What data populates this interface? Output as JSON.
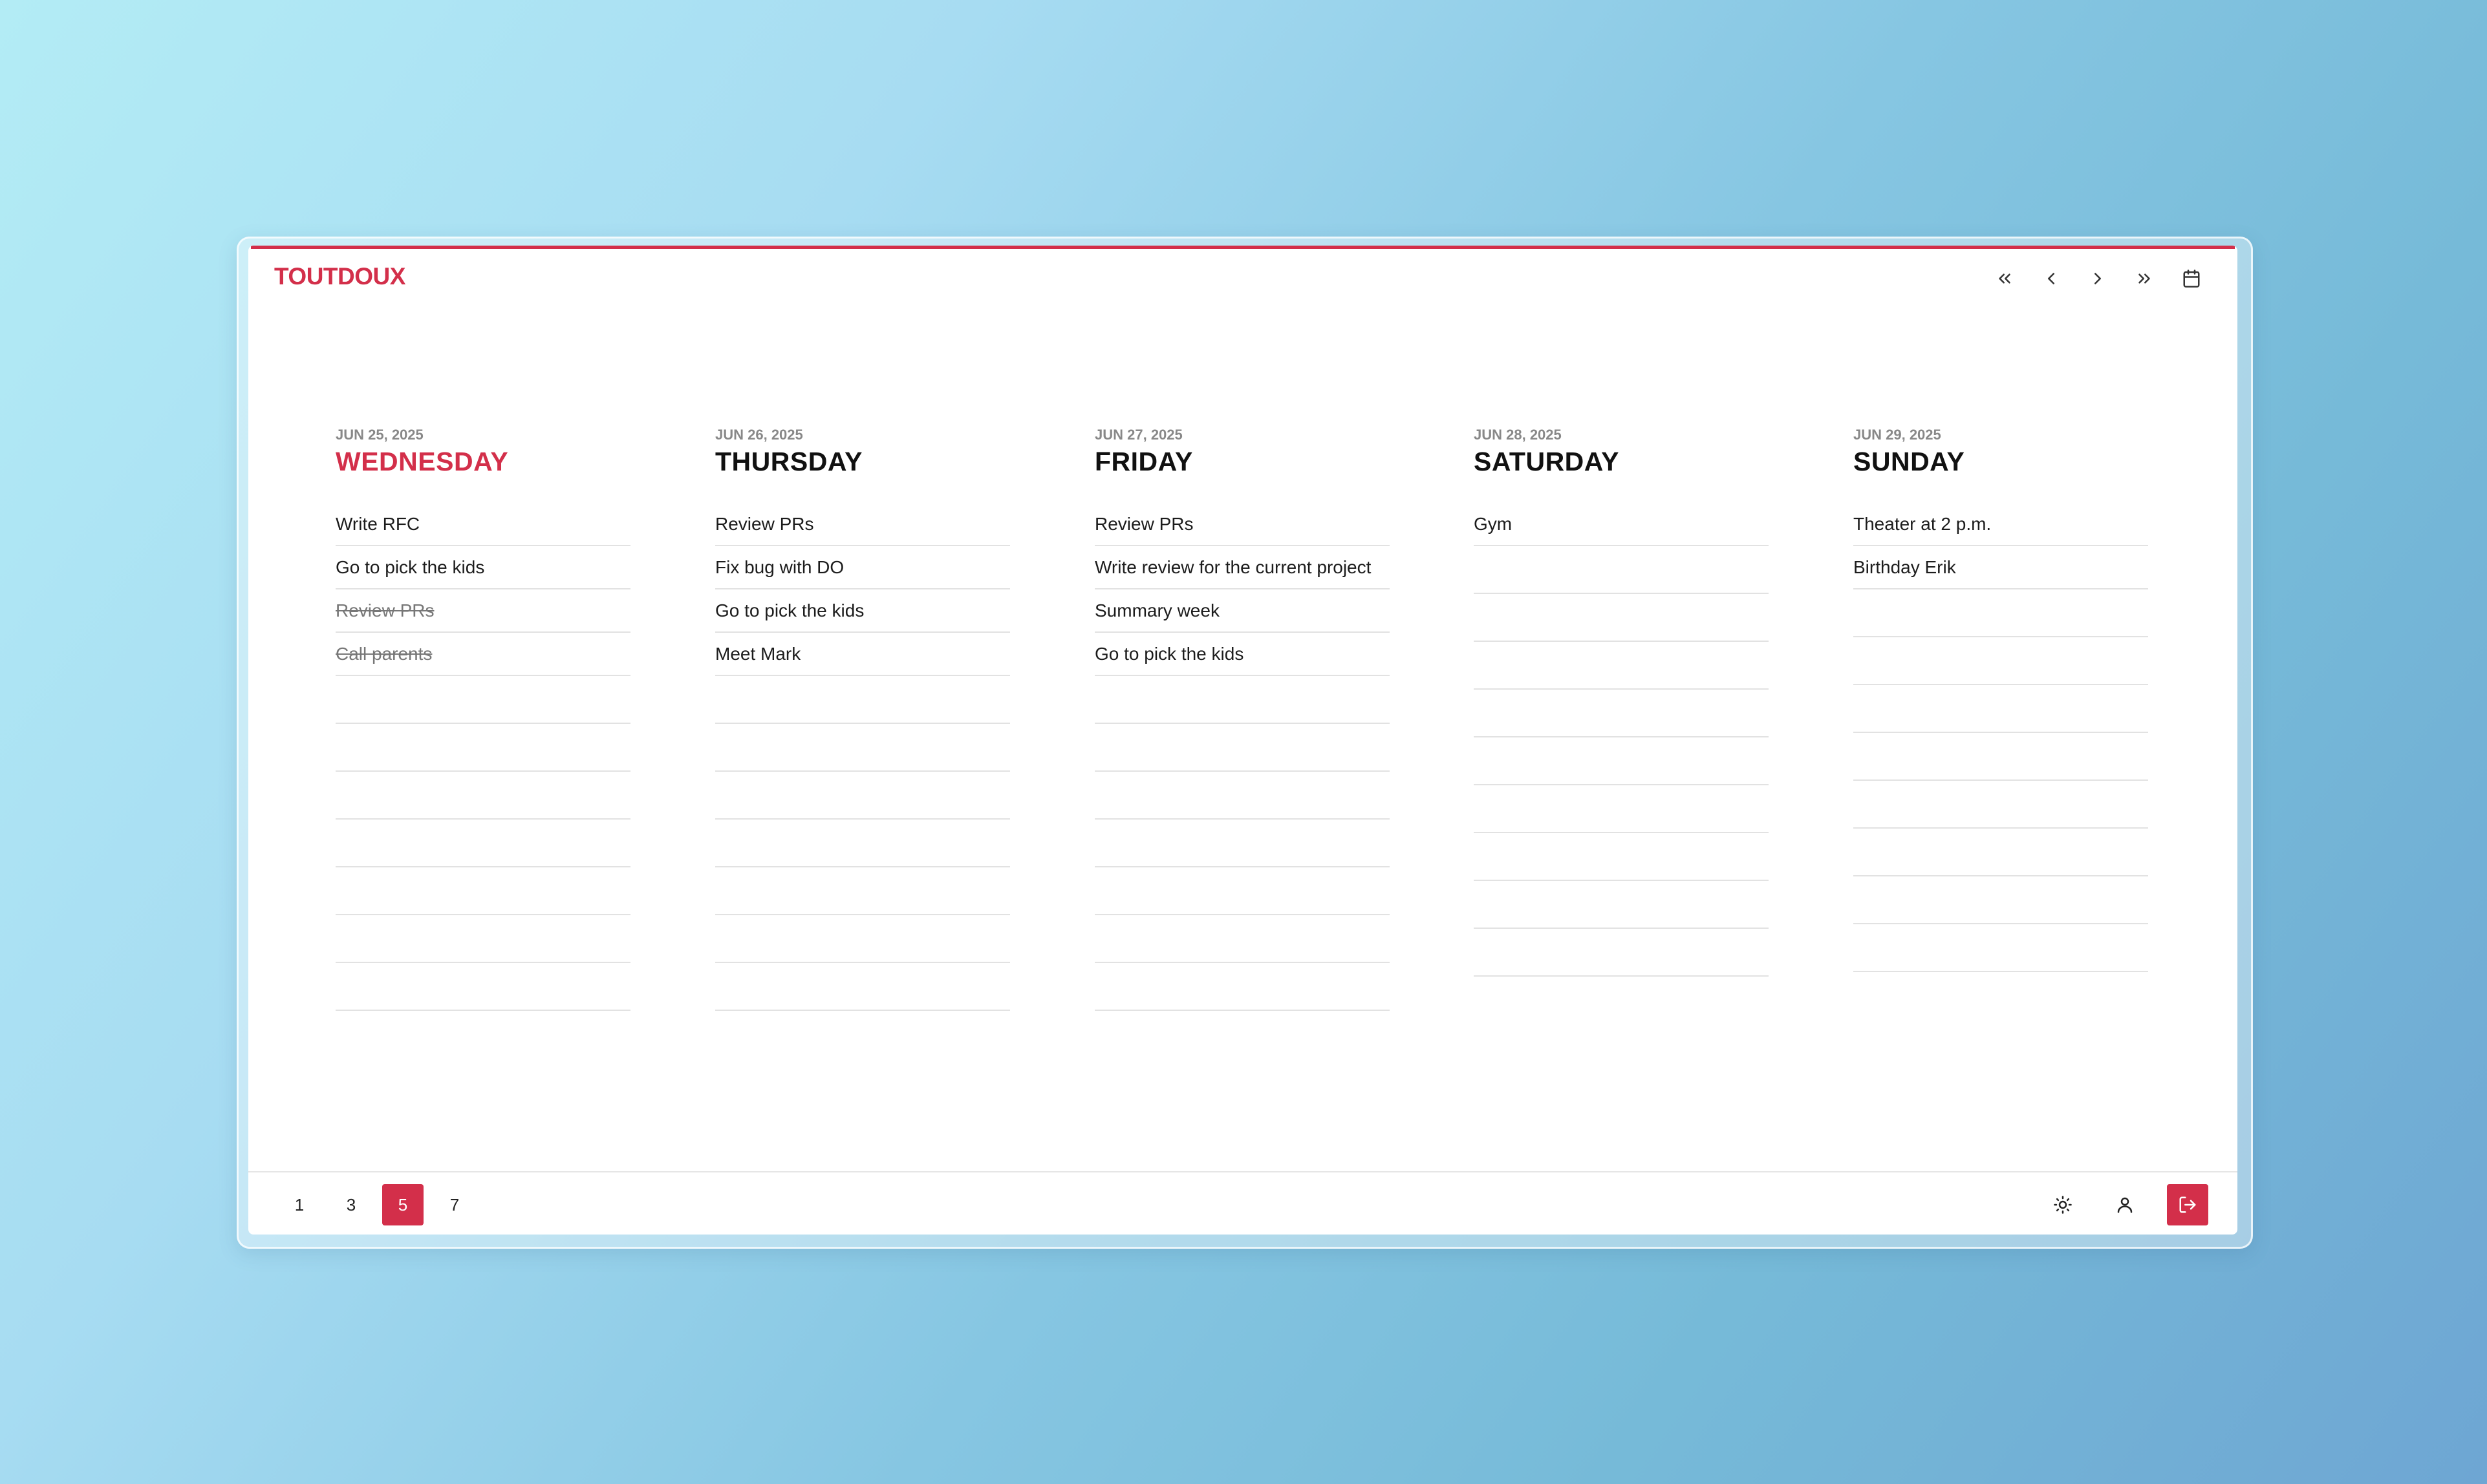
{
  "app": {
    "title": "TOUTDOUX"
  },
  "colors": {
    "accent": "#d32f4a",
    "background_from": "#b3ecf5",
    "background_to": "#6ea6d3"
  },
  "toolbar": {
    "icons": [
      "chevrons-left-icon",
      "chevron-left-icon",
      "chevron-right-icon",
      "chevrons-right-icon",
      "calendar-icon"
    ]
  },
  "days": [
    {
      "date": "JUN 25, 2025",
      "name": "WEDNESDAY",
      "today": true,
      "tasks": [
        {
          "text": "Write RFC",
          "done": false
        },
        {
          "text": "Go to pick the kids",
          "done": false
        },
        {
          "text": "Review PRs",
          "done": true
        },
        {
          "text": "Call parents",
          "done": true
        }
      ]
    },
    {
      "date": "JUN 26, 2025",
      "name": "THURSDAY",
      "today": false,
      "tasks": [
        {
          "text": "Review PRs",
          "done": false
        },
        {
          "text": "Fix bug with DO",
          "done": false
        },
        {
          "text": "Go to pick the kids",
          "done": false
        },
        {
          "text": "Meet Mark",
          "done": false
        }
      ]
    },
    {
      "date": "JUN 27, 2025",
      "name": "FRIDAY",
      "today": false,
      "tasks": [
        {
          "text": "Review PRs",
          "done": false
        },
        {
          "text": "Write review for the current project",
          "done": false
        },
        {
          "text": "Summary week",
          "done": false
        },
        {
          "text": "Go to pick the kids",
          "done": false
        }
      ]
    },
    {
      "date": "JUN 28, 2025",
      "name": "SATURDAY",
      "today": false,
      "tasks": [
        {
          "text": "Gym",
          "done": false
        }
      ]
    },
    {
      "date": "JUN 29, 2025",
      "name": "SUNDAY",
      "today": false,
      "tasks": [
        {
          "text": "Theater at 2 p.m.",
          "done": false
        },
        {
          "text": "Birthday Erik",
          "done": false
        }
      ]
    }
  ],
  "footer": {
    "day_counts": [
      "1",
      "3",
      "5",
      "7"
    ],
    "selected_count": "5",
    "icons": [
      "sun-icon",
      "user-icon",
      "logout-icon"
    ]
  }
}
